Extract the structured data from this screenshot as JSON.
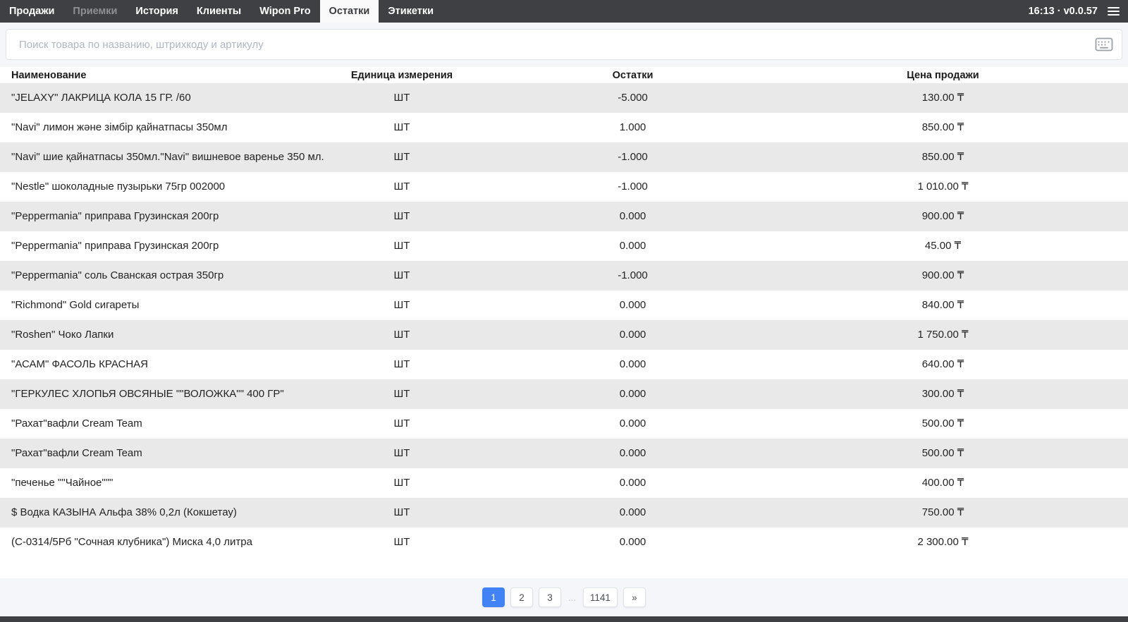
{
  "nav": {
    "items": [
      {
        "id": "sales",
        "label": "Продажи",
        "state": "normal"
      },
      {
        "id": "receivings",
        "label": "Приемки",
        "state": "dimmed"
      },
      {
        "id": "history",
        "label": "История",
        "state": "normal"
      },
      {
        "id": "clients",
        "label": "Клиенты",
        "state": "normal"
      },
      {
        "id": "wipon-pro",
        "label": "Wipon Pro",
        "state": "normal"
      },
      {
        "id": "stock",
        "label": "Остатки",
        "state": "active"
      },
      {
        "id": "labels",
        "label": "Этикетки",
        "state": "normal"
      }
    ],
    "time": "16:13",
    "separator": "·",
    "version": "v0.0.57"
  },
  "search": {
    "placeholder": "Поиск товара по названию, штрихкоду и артикулу",
    "icon": "keyboard-icon"
  },
  "table": {
    "columns": [
      "Наименование",
      "Единица измерения",
      "Остатки",
      "Цена продажи"
    ],
    "rows": [
      {
        "name": "\"JELAXY\" ЛАКРИЦА КОЛА 15 ГР. /60",
        "unit": "ШТ",
        "qty": "-5.000",
        "price": "130.00 ₸"
      },
      {
        "name": "\"Navi\" лимон және зімбір қайнатпасы 350мл",
        "unit": "ШТ",
        "qty": "1.000",
        "price": "850.00 ₸"
      },
      {
        "name": "\"Navi\" шие қайнатпасы 350мл.\"Navi\" вишневое варенье 350 мл.",
        "unit": "ШТ",
        "qty": "-1.000",
        "price": "850.00 ₸"
      },
      {
        "name": "\"Nestle\" шоколадные пузырьки 75гр 002000",
        "unit": "ШТ",
        "qty": "-1.000",
        "price": "1 010.00 ₸"
      },
      {
        "name": "\"Peppermania\" приправа Грузинская 200гр",
        "unit": "ШТ",
        "qty": "0.000",
        "price": "900.00 ₸"
      },
      {
        "name": "\"Peppermania\" приправа Грузинская 200гр",
        "unit": "ШТ",
        "qty": "0.000",
        "price": "45.00 ₸"
      },
      {
        "name": "\"Peppermania\" соль Сванская острая 350гр",
        "unit": "ШТ",
        "qty": "-1.000",
        "price": "900.00 ₸"
      },
      {
        "name": "\"Richmond\" Gold сигареты",
        "unit": "ШТ",
        "qty": "0.000",
        "price": "840.00 ₸"
      },
      {
        "name": "\"Roshen\" Чоко Лапки",
        "unit": "ШТ",
        "qty": "0.000",
        "price": "1 750.00 ₸"
      },
      {
        "name": "\"АСАМ\" ФАСОЛЬ КРАСНАЯ",
        "unit": "ШТ",
        "qty": "0.000",
        "price": "640.00 ₸"
      },
      {
        "name": "\"ГЕРКУЛЕС ХЛОПЬЯ ОВСЯНЫЕ \"\"ВОЛОЖКА\"\" 400 ГР\"",
        "unit": "ШТ",
        "qty": "0.000",
        "price": "300.00 ₸"
      },
      {
        "name": "\"Рахат\"вафли Cream Team",
        "unit": "ШТ",
        "qty": "0.000",
        "price": "500.00 ₸"
      },
      {
        "name": "\"Рахат\"вафли Cream Team",
        "unit": "ШТ",
        "qty": "0.000",
        "price": "500.00 ₸"
      },
      {
        "name": "\"печенье \"\"Чайное\"\"\"",
        "unit": "ШТ",
        "qty": "0.000",
        "price": "400.00 ₸"
      },
      {
        "name": "$ Водка КАЗЫНА Альфа 38% 0,2л (Кокшетау)",
        "unit": "ШТ",
        "qty": "0.000",
        "price": "750.00 ₸"
      },
      {
        "name": "(С-0314/5Рб \"Сочная клубника\") Миска 4,0 литра",
        "unit": "ШТ",
        "qty": "0.000",
        "price": "2 300.00 ₸"
      }
    ]
  },
  "pagination": {
    "items": [
      {
        "label": "1",
        "type": "page",
        "active": true
      },
      {
        "label": "2",
        "type": "page"
      },
      {
        "label": "3",
        "type": "page"
      },
      {
        "label": "...",
        "type": "ellipsis"
      },
      {
        "label": "1141",
        "type": "page"
      },
      {
        "label": "»",
        "type": "next"
      }
    ]
  },
  "colors": {
    "nav_bg": "#3f4043",
    "accent": "#4183f4",
    "row_alt": "#e9e9e9",
    "section_bg": "#f5f6fa"
  }
}
